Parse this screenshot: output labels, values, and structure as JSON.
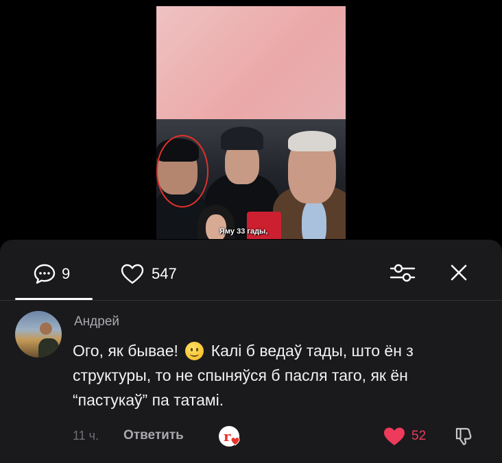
{
  "video": {
    "caption": "Яму 33 гады,"
  },
  "tabs": {
    "comments_count": "9",
    "likes_count": "547"
  },
  "comment": {
    "author": "Андрей",
    "text_part1": "Ого, як бывае!",
    "text_part2": "Калі б ведаў тады, што ён з структуры, то не спыняўся б пасля таго, як ён “пастукаў” па татамі.",
    "time": "11 ч.",
    "reply_label": "Ответить",
    "likes": "52"
  },
  "colors": {
    "sheet_bg": "#1a1a1d",
    "like_red": "#ee3a5b",
    "muted_text": "#a9a9ae"
  },
  "icons": [
    "comment-bubble-icon",
    "heart-outline-icon",
    "filter-sliders-icon",
    "close-icon",
    "creator-badge-icon",
    "heart-filled-icon",
    "thumbs-down-icon",
    "smile-emoji-icon"
  ]
}
